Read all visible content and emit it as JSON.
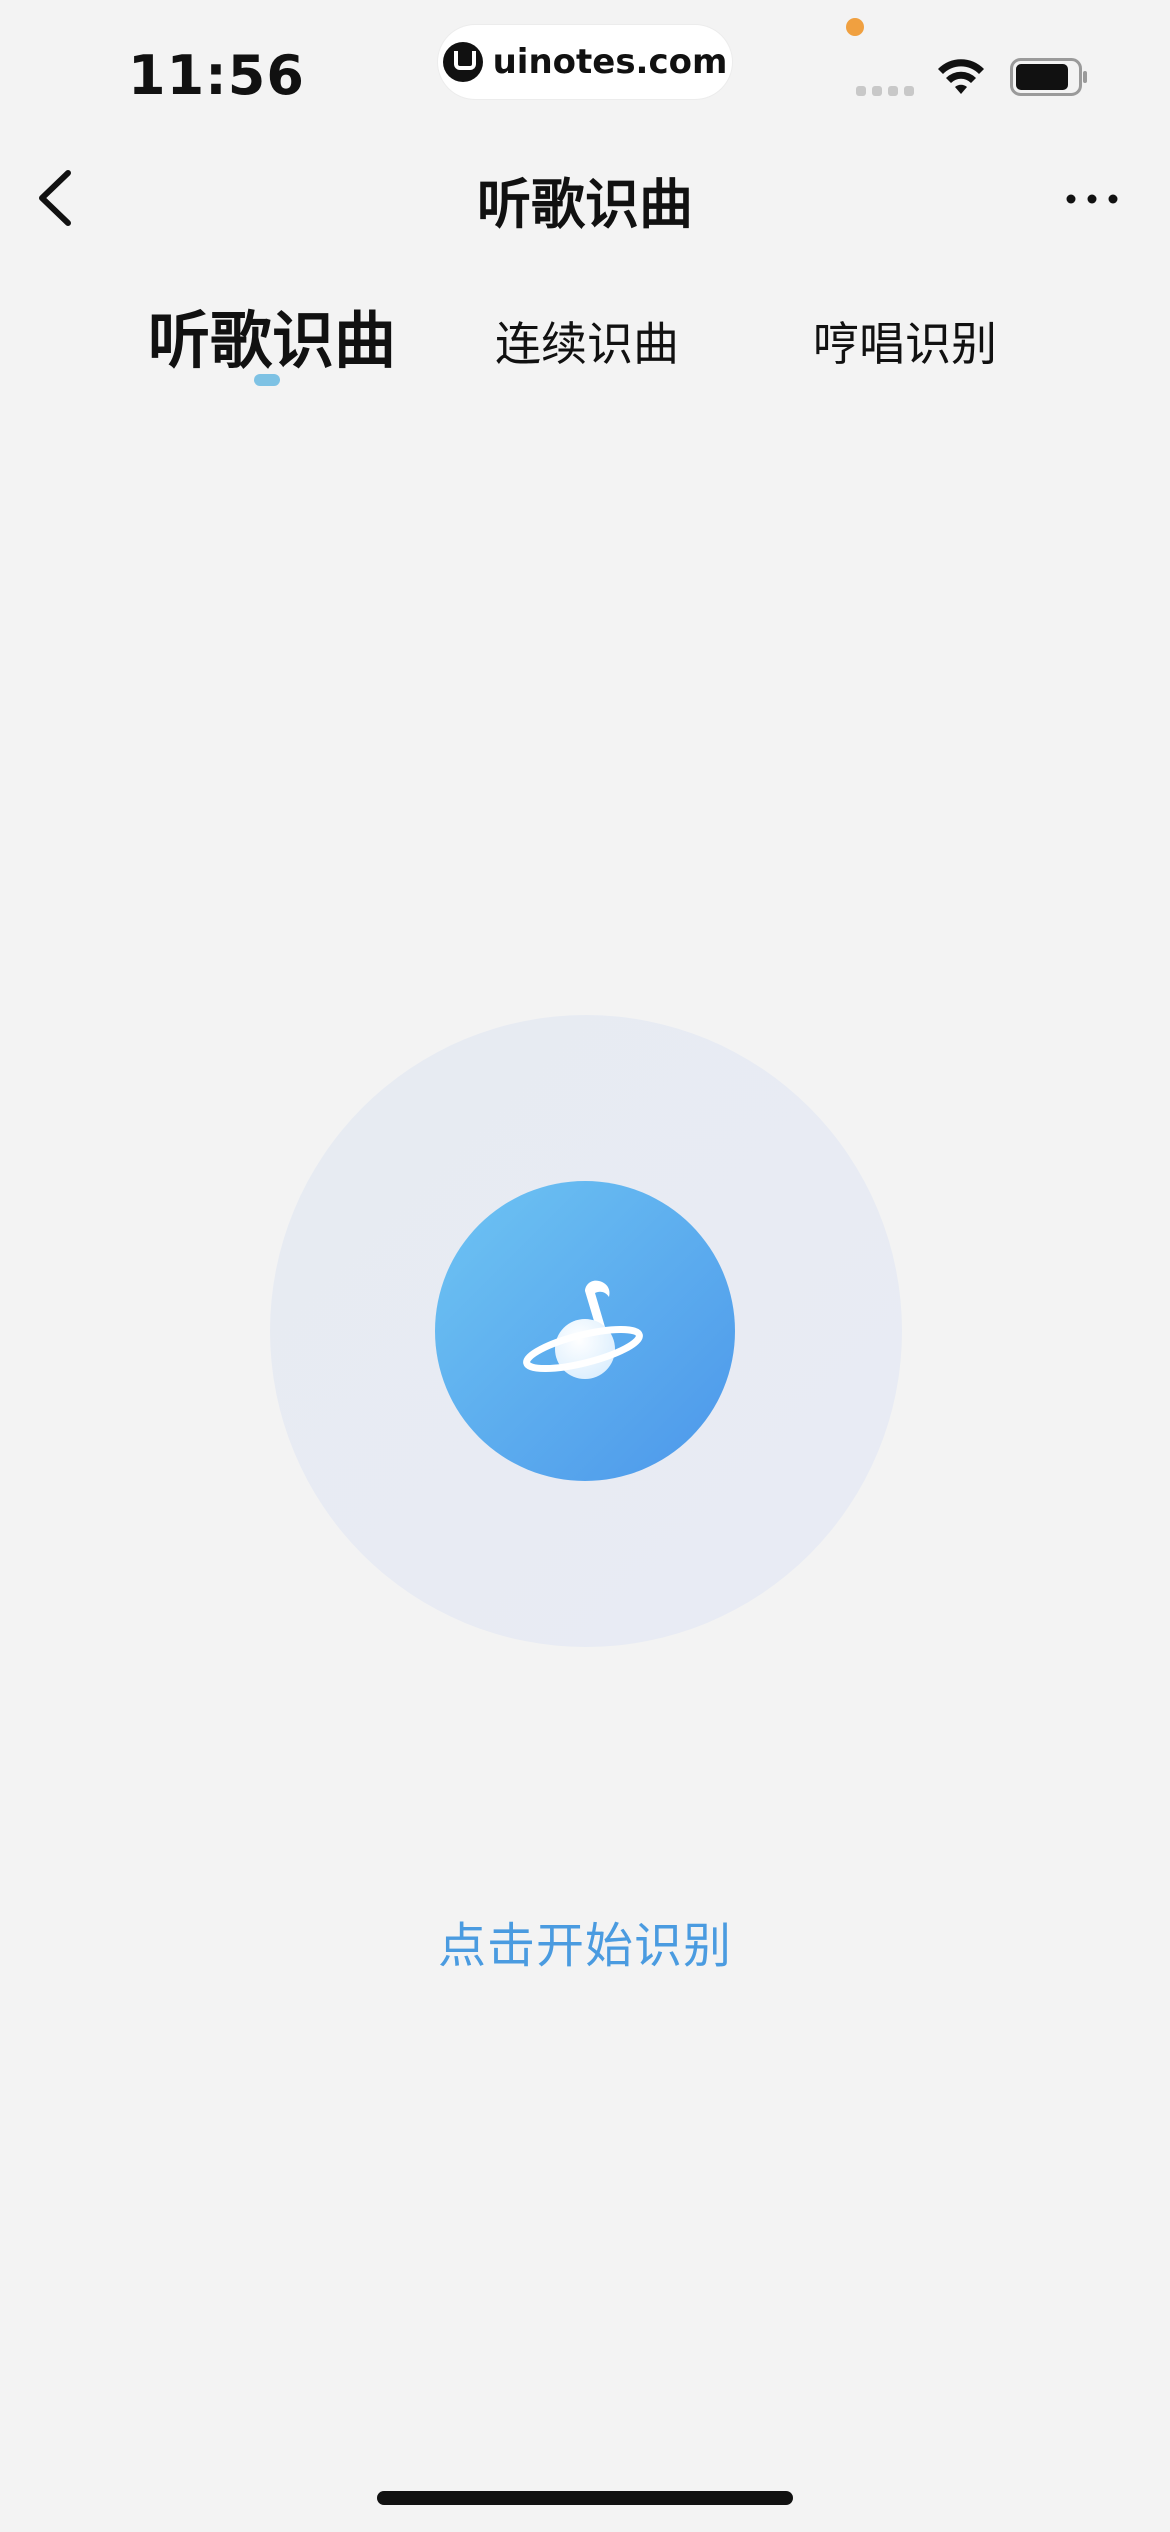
{
  "status_bar": {
    "time": "11:56",
    "url": "uinotes.com",
    "icons": [
      "cellular-signal-icon",
      "wifi-icon",
      "battery-icon"
    ],
    "accent_dot_color": "#f0a040"
  },
  "nav": {
    "title": "听歌识曲",
    "back_icon": "chevron-left-icon",
    "more_icon": "more-horizontal-icon"
  },
  "tabs": [
    {
      "label": "听歌识曲",
      "active": true
    },
    {
      "label": "连续识曲",
      "active": false
    },
    {
      "label": "哼唱识别",
      "active": false
    }
  ],
  "recognize": {
    "icon": "music-planet-icon",
    "hint": "点击开始识别",
    "button_colors": [
      "#6ec4f3",
      "#4c97ea"
    ],
    "hint_color": "#4a9be0"
  }
}
